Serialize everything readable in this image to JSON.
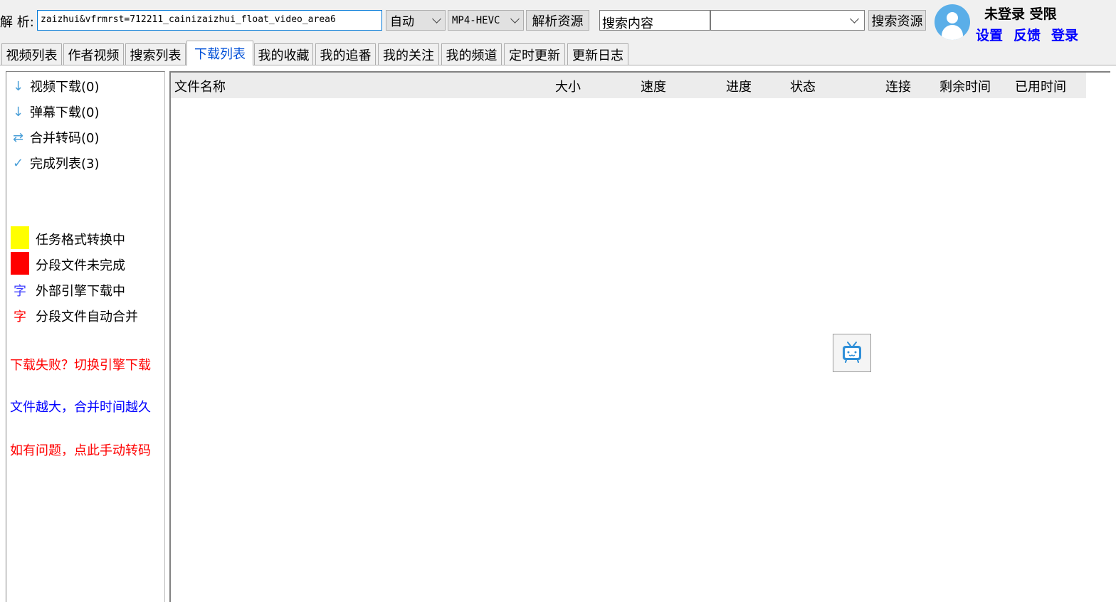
{
  "toolbar": {
    "parse_label": "解 析:",
    "url_value": "zaizhui&vfrmrst=712211_cainizaizhui_float_video_area6",
    "quality_value": "自动",
    "format_value": "MP4-HEVC",
    "parse_button": "解析资源",
    "search_value": "搜索内容",
    "search_type_value": "",
    "search_button": "搜索资源"
  },
  "user": {
    "status": "未登录 受限",
    "settings_link": "设置",
    "feedback_link": "反馈",
    "login_link": "登录"
  },
  "tabs": [
    {
      "label": "视频列表"
    },
    {
      "label": "作者视频"
    },
    {
      "label": "搜索列表"
    },
    {
      "label": "下载列表"
    },
    {
      "label": "我的收藏"
    },
    {
      "label": "我的追番"
    },
    {
      "label": "我的关注"
    },
    {
      "label": "我的频道"
    },
    {
      "label": "定时更新"
    },
    {
      "label": "更新日志"
    }
  ],
  "active_tab": "下载列表",
  "sidebar": {
    "items": [
      {
        "icon": "↓",
        "label": "视频下载(0)"
      },
      {
        "icon": "↓",
        "label": "弹幕下载(0)"
      },
      {
        "icon": "⇄",
        "label": "合并转码(0)"
      },
      {
        "icon": "✓",
        "label": "完成列表(3)"
      }
    ],
    "legend": [
      {
        "color": "#ffff00",
        "label": "任务格式转换中"
      },
      {
        "color": "#ff0000",
        "label": "分段文件未完成"
      },
      {
        "char": "字",
        "char_color": "#4040ff",
        "label": "外部引擎下载中"
      },
      {
        "char": "字",
        "char_color": "#ff0000",
        "label": "分段文件自动合并"
      }
    ],
    "hints": [
      {
        "text": "下载失败？切换引擎下载",
        "color": "#ff0000"
      },
      {
        "text": "文件越大，合并时间越久",
        "color": "#0000ff"
      },
      {
        "text": "如有问题，点此手动转码",
        "color": "#ff0000"
      }
    ]
  },
  "table": {
    "columns": [
      "文件名称",
      "大小",
      "速度",
      "进度",
      "状态",
      "连接",
      "剩余时间",
      "已用时间"
    ]
  },
  "icons": {
    "tv": "bilibili-tv-icon",
    "avatar": "user-avatar-icon"
  }
}
